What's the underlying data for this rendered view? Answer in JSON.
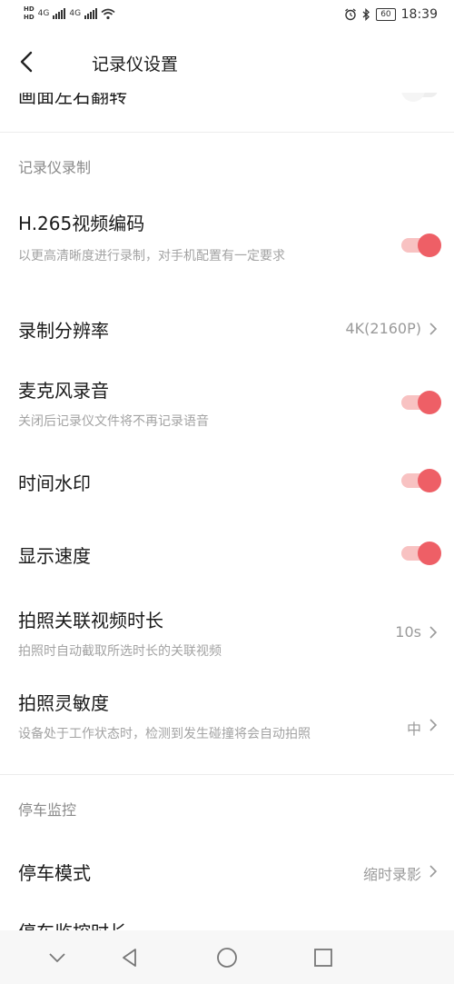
{
  "status_bar": {
    "hd1": "HD",
    "hd2": "HD",
    "net1": "4G",
    "net2": "4G",
    "battery": "60",
    "time": "18:39"
  },
  "header": {
    "title": "记录仪设置"
  },
  "items": {
    "mirror": {
      "title": "画面左右翻转",
      "toggle": "off"
    },
    "section_record": "记录仪录制",
    "h265": {
      "title": "H.265视频编码",
      "subtitle": "以更高清晰度进行录制，对手机配置有一定要求",
      "toggle": "on"
    },
    "resolution": {
      "title": "录制分辨率",
      "value": "4K(2160P)"
    },
    "mic": {
      "title": "麦克风录音",
      "subtitle": "关闭后记录仪文件将不再记录语音",
      "toggle": "on"
    },
    "watermark": {
      "title": "时间水印",
      "toggle": "on"
    },
    "speed": {
      "title": "显示速度",
      "toggle": "on"
    },
    "photo_video": {
      "title": "拍照关联视频时长",
      "subtitle": "拍照时自动截取所选时长的关联视频",
      "value": "10s"
    },
    "sensitivity": {
      "title": "拍照灵敏度",
      "subtitle": "设备处于工作状态时，检测到发生碰撞将会自动拍照",
      "value": "中"
    },
    "section_parking": "停车监控",
    "parking_mode": {
      "title": "停车模式",
      "value": "缩时录影"
    },
    "parking_duration": {
      "title": "停车监控时长"
    }
  },
  "colors": {
    "accent": "#ee5f66",
    "accent_track": "#f8c2c2"
  },
  "nav_icons": [
    "chevron-down-icon",
    "back-triangle-icon",
    "home-circle-icon",
    "recents-square-icon"
  ]
}
